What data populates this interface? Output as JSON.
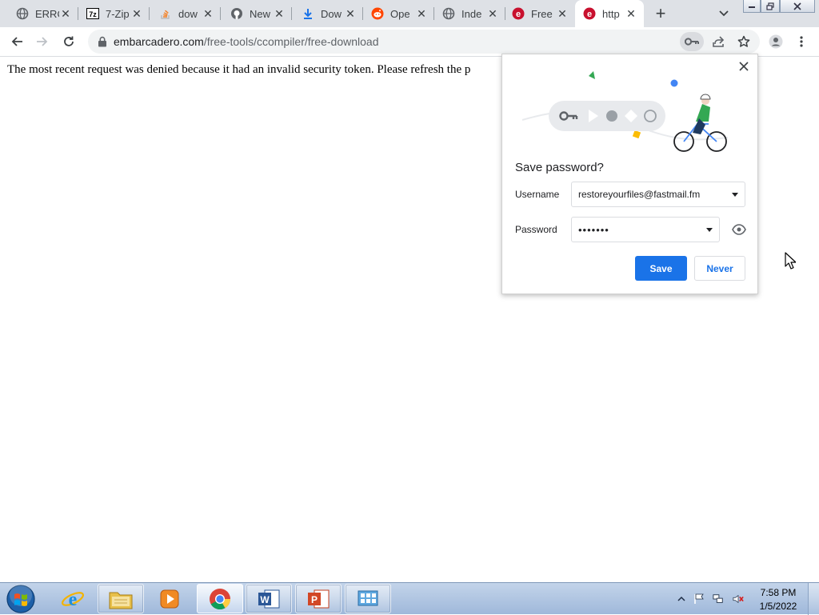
{
  "tabs": [
    {
      "title": "ERRO",
      "icon": "globe-icon"
    },
    {
      "title": "7-Zip",
      "icon": "7zip-icon"
    },
    {
      "title": "dow",
      "icon": "stackoverflow-icon"
    },
    {
      "title": "New",
      "icon": "github-icon"
    },
    {
      "title": "Dow",
      "icon": "download-icon"
    },
    {
      "title": "Ope",
      "icon": "reddit-icon"
    },
    {
      "title": "Inde",
      "icon": "globe-icon"
    },
    {
      "title": "Free",
      "icon": "embarcadero-icon"
    },
    {
      "title": "http",
      "icon": "embarcadero-icon",
      "active": true
    }
  ],
  "omnibox": {
    "domain": "embarcadero.com",
    "path": "/free-tools/ccompiler/free-download"
  },
  "page": {
    "message": "The most recent request was denied because it had an invalid security token. Please refresh the p"
  },
  "password_bubble": {
    "title": "Save password?",
    "username_label": "Username",
    "username_value": "restoreyourfiles@fastmail.fm",
    "password_label": "Password",
    "password_value": "•••••••",
    "save_label": "Save",
    "never_label": "Never"
  },
  "taskbar": {
    "apps": [
      "internet-explorer",
      "file-explorer",
      "media-player",
      "chrome",
      "word",
      "powerpoint",
      "control-panel"
    ],
    "clock_time": "7:58 PM",
    "clock_date": "1/5/2022"
  },
  "colors": {
    "accent": "#1a73e8",
    "tabstrip": "#dee1e6",
    "omnibox": "#f1f3f4"
  }
}
